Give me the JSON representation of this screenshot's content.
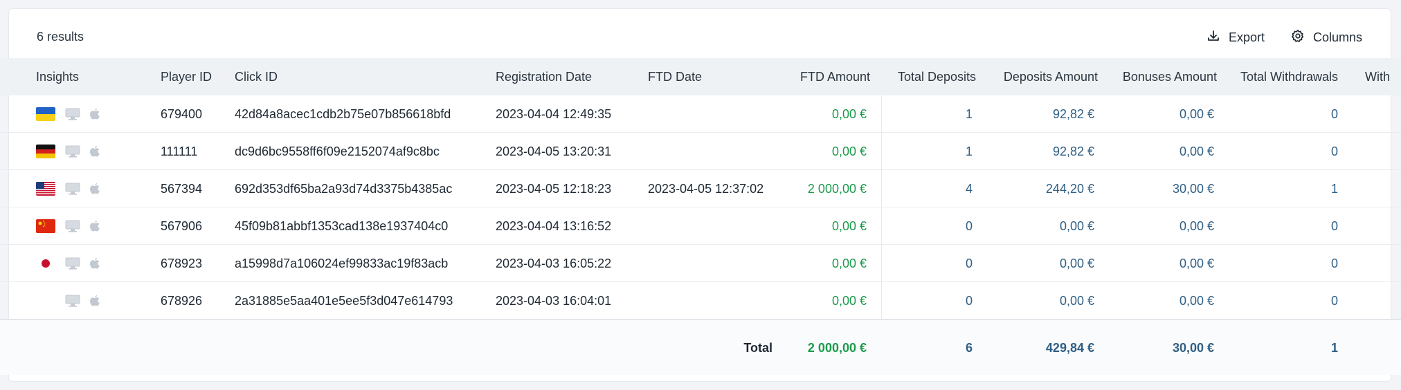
{
  "toolbar": {
    "results": "6 results",
    "export_label": "Export",
    "columns_label": "Columns"
  },
  "columns": {
    "insights": "Insights",
    "player_id": "Player ID",
    "click_id": "Click ID",
    "registration_date": "Registration Date",
    "ftd_date": "FTD Date",
    "ftd_amount": "FTD Amount",
    "total_deposits": "Total Deposits",
    "deposits_amount": "Deposits Amount",
    "bonuses_amount": "Bonuses Amount",
    "total_withdrawals": "Total Withdrawals",
    "withdrawals_partial": "With"
  },
  "rows": [
    {
      "flag": "ukraine-flag-icon",
      "player_id": "679400",
      "click_id": "42d84a8acec1cdb2b75e07b856618bfd",
      "registration_date": "2023-04-04 12:49:35",
      "ftd_date": "",
      "ftd_amount": "0,00 €",
      "total_deposits": "1",
      "deposits_amount": "92,82 €",
      "bonuses_amount": "0,00 €",
      "total_withdrawals": "0"
    },
    {
      "flag": "germany-flag-icon",
      "player_id": "111111",
      "click_id": "dc9d6bc9558ff6f09e2152074af9c8bc",
      "registration_date": "2023-04-05 13:20:31",
      "ftd_date": "",
      "ftd_amount": "0,00 €",
      "total_deposits": "1",
      "deposits_amount": "92,82 €",
      "bonuses_amount": "0,00 €",
      "total_withdrawals": "0"
    },
    {
      "flag": "usa-flag-icon",
      "player_id": "567394",
      "click_id": "692d353df65ba2a93d74d3375b4385ac",
      "registration_date": "2023-04-05 12:18:23",
      "ftd_date": "2023-04-05 12:37:02",
      "ftd_amount": "2 000,00 €",
      "total_deposits": "4",
      "deposits_amount": "244,20 €",
      "bonuses_amount": "30,00 €",
      "total_withdrawals": "1"
    },
    {
      "flag": "china-flag-icon",
      "player_id": "567906",
      "click_id": "45f09b81abbf1353cad138e1937404c0",
      "registration_date": "2023-04-04 13:16:52",
      "ftd_date": "",
      "ftd_amount": "0,00 €",
      "total_deposits": "0",
      "deposits_amount": "0,00 €",
      "bonuses_amount": "0,00 €",
      "total_withdrawals": "0"
    },
    {
      "flag": "japan-flag-icon",
      "player_id": "678923",
      "click_id": "a15998d7a106024ef99833ac19f83acb",
      "registration_date": "2023-04-03 16:05:22",
      "ftd_date": "",
      "ftd_amount": "0,00 €",
      "total_deposits": "0",
      "deposits_amount": "0,00 €",
      "bonuses_amount": "0,00 €",
      "total_withdrawals": "0"
    },
    {
      "flag": "",
      "player_id": "678926",
      "click_id": "2a31885e5aa401e5ee5f3d047e614793",
      "registration_date": "2023-04-03 16:04:01",
      "ftd_date": "",
      "ftd_amount": "0,00 €",
      "total_deposits": "0",
      "deposits_amount": "0,00 €",
      "bonuses_amount": "0,00 €",
      "total_withdrawals": "0"
    }
  ],
  "totals": {
    "label": "Total",
    "ftd_amount": "2 000,00 €",
    "total_deposits": "6",
    "deposits_amount": "429,84 €",
    "bonuses_amount": "30,00 €",
    "total_withdrawals": "1"
  },
  "icons": {
    "device": "desktop-icon",
    "os": "apple-icon",
    "export": "download-icon",
    "columns": "gear-icon"
  },
  "colors": {
    "positive": "#1a9b4b",
    "value": "#2f5f85",
    "header_bg": "#eff2f5"
  }
}
